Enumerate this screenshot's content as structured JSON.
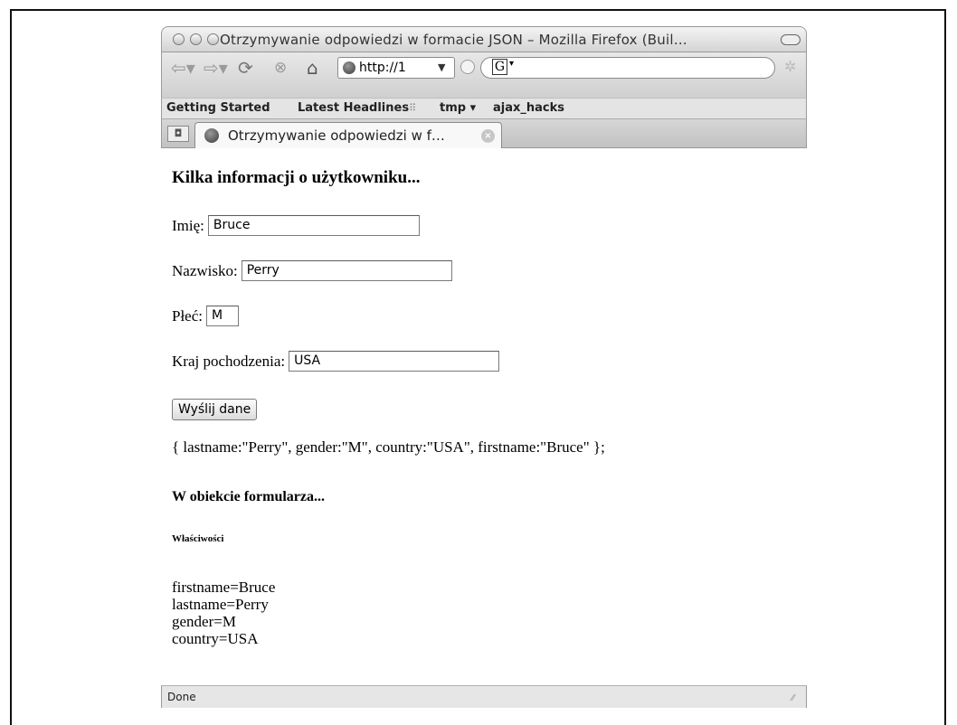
{
  "window": {
    "title": "Otrzymywanie odpowiedzi w formacie JSON – Mozilla Firefox (Buil…"
  },
  "toolbar": {
    "url": "http://1",
    "search_engine": "G"
  },
  "bookmarks": [
    {
      "label": "Getting Started"
    },
    {
      "label": "Latest Headlines",
      "meta": "⠿"
    },
    {
      "label": "tmp ▾"
    },
    {
      "label": "ajax_hacks"
    }
  ],
  "tab": {
    "label": "Otrzymywanie odpowiedzi w f…"
  },
  "page": {
    "heading": "Kilka informacji o użytkowniku...",
    "fields": [
      {
        "label": "Imię:",
        "value": "Bruce"
      },
      {
        "label": "Nazwisko:",
        "value": "Perry"
      },
      {
        "label": "Płeć:",
        "value": "M"
      },
      {
        "label": "Kraj pochodzenia:",
        "value": "USA"
      }
    ],
    "submit_label": "Wyślij dane",
    "json_output": "{ lastname:\"Perry\", gender:\"M\", country:\"USA\", firstname:\"Bruce\" };",
    "form_heading": "W obiekcie formularza...",
    "props_heading": "Właściwości",
    "properties": [
      "firstname=Bruce",
      "lastname=Perry",
      "gender=M",
      "country=USA"
    ]
  },
  "status": {
    "text": "Done"
  }
}
